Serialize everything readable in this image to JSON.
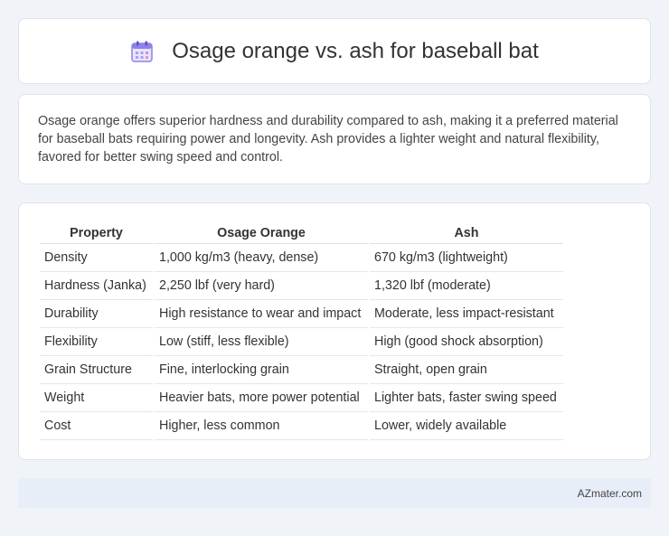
{
  "header": {
    "title": "Osage orange vs. ash for baseball bat",
    "icon": "calendar-icon"
  },
  "description": {
    "text": "Osage orange offers superior hardness and durability compared to ash, making it a preferred material for baseball bats requiring power and longevity. Ash provides a lighter weight and natural flexibility, favored for better swing speed and control."
  },
  "table": {
    "headers": [
      "Property",
      "Osage Orange",
      "Ash"
    ],
    "rows": [
      [
        "Density",
        "1,000 kg/m3 (heavy, dense)",
        "670 kg/m3 (lightweight)"
      ],
      [
        "Hardness (Janka)",
        "2,250 lbf (very hard)",
        "1,320 lbf (moderate)"
      ],
      [
        "Durability",
        "High resistance to wear and impact",
        "Moderate, less impact-resistant"
      ],
      [
        "Flexibility",
        "Low (stiff, less flexible)",
        "High (good shock absorption)"
      ],
      [
        "Grain Structure",
        "Fine, interlocking grain",
        "Straight, open grain"
      ],
      [
        "Weight",
        "Heavier bats, more power potential",
        "Lighter bats, faster swing speed"
      ],
      [
        "Cost",
        "Higher, less common",
        "Lower, widely available"
      ]
    ]
  },
  "footer": {
    "brand": "AZmater.com"
  },
  "colors": {
    "background": "#f0f3f8",
    "card": "#ffffff",
    "footer_bg": "#e8eef8",
    "icon_accent": "#7b6fe0"
  }
}
